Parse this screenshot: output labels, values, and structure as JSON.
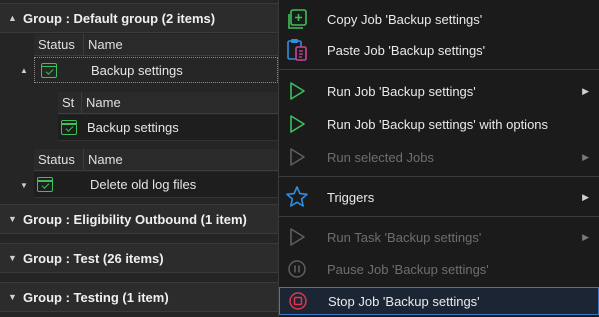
{
  "groups": [
    {
      "label": "Group : Default group (2 items)"
    },
    {
      "label": "Group : Eligibility Outbound (1 item)"
    },
    {
      "label": "Group : Test (26 items)"
    },
    {
      "label": "Group : Testing (1 item)"
    }
  ],
  "columns": {
    "status": "Status",
    "name": "Name",
    "status_short": "St"
  },
  "jobs": [
    {
      "name": "Backup settings"
    },
    {
      "name": "Backup settings"
    },
    {
      "name": "Delete old log files"
    }
  ],
  "menu": {
    "items": [
      {
        "label": "Copy Job 'Backup settings'",
        "icon": "copy-icon",
        "disabled": false
      },
      {
        "label": "Paste Job 'Backup settings'",
        "icon": "paste-icon",
        "disabled": false
      },
      {
        "label": "Run Job 'Backup settings'",
        "icon": "play-icon",
        "disabled": false,
        "submenu": true
      },
      {
        "label": "Run Job 'Backup settings' with options",
        "icon": "play-icon",
        "disabled": false
      },
      {
        "label": "Run selected Jobs",
        "icon": "play-icon",
        "disabled": true,
        "submenu": true
      },
      {
        "label": "Triggers",
        "icon": "star-icon",
        "disabled": false,
        "submenu": true
      },
      {
        "label": "Run Task 'Backup settings'",
        "icon": "play-icon",
        "disabled": true,
        "submenu": true
      },
      {
        "label": "Pause Job 'Backup settings'",
        "icon": "pause-icon",
        "disabled": true
      },
      {
        "label": "Stop Job 'Backup settings'",
        "icon": "stop-icon",
        "disabled": false
      }
    ]
  },
  "colors": {
    "green": "#3cc05a",
    "blue": "#2f8fe0",
    "red": "#e0354b",
    "highlight": "#3a78c8"
  }
}
